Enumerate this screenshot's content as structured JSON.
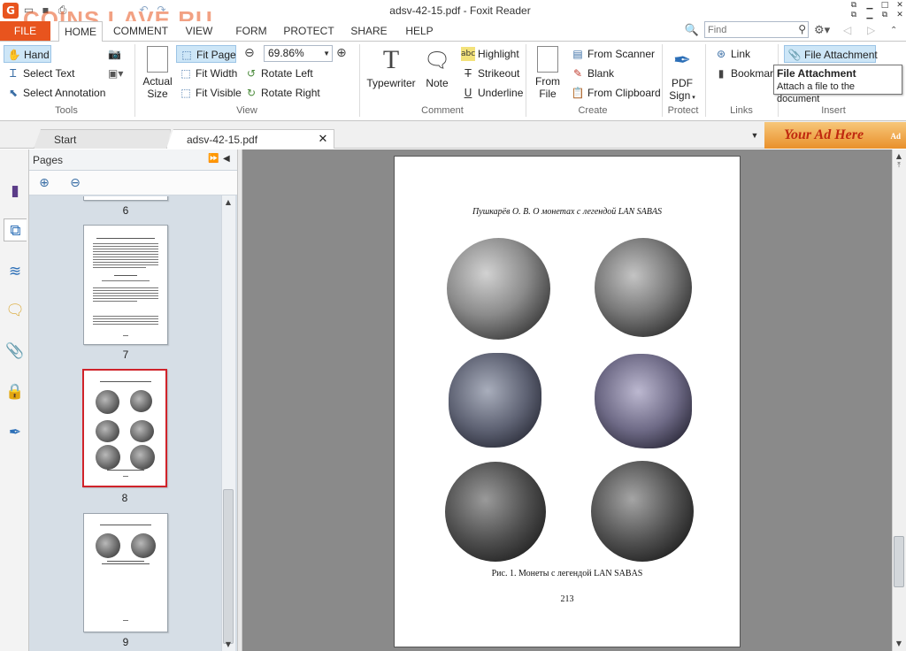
{
  "watermark": "COINS LAVE.RU",
  "window": {
    "title": "adsv-42-15.pdf - Foxit Reader"
  },
  "ribbon_tabs": [
    "FILE",
    "HOME",
    "COMMENT",
    "VIEW",
    "FORM",
    "PROTECT",
    "SHARE",
    "HELP"
  ],
  "find": {
    "placeholder": "Find"
  },
  "tools": {
    "hand": "Hand",
    "select_text": "Select Text",
    "select_annotation": "Select Annotation",
    "group": "Tools"
  },
  "view": {
    "actual_size": "Actual Size",
    "actual_size_l1": "Actual",
    "actual_size_l2": "Size",
    "fit_page": "Fit Page",
    "fit_width": "Fit Width",
    "fit_visible": "Fit Visible",
    "zoom_value": "69.86%",
    "rotate_left": "Rotate Left",
    "rotate_right": "Rotate Right",
    "group": "View"
  },
  "comment": {
    "typewriter": "Typewriter",
    "note": "Note",
    "highlight": "Highlight",
    "strikeout": "Strikeout",
    "underline": "Underline",
    "group": "Comment"
  },
  "create": {
    "from_file_l1": "From",
    "from_file_l2": "File",
    "from_scanner": "From Scanner",
    "blank": "Blank",
    "from_clipboard": "From Clipboard",
    "group": "Create"
  },
  "protect": {
    "pdf_sign_l1": "PDF",
    "pdf_sign_l2": "Sign",
    "group": "Protect"
  },
  "links": {
    "link": "Link",
    "bookmark": "Bookmark",
    "group": "Links"
  },
  "insert": {
    "file_attachment": "File Attachment",
    "group": "Insert"
  },
  "tooltip": {
    "title": "File Attachment",
    "body": "Attach a file to the document"
  },
  "doc_tabs": [
    {
      "label": "Start"
    },
    {
      "label": "adsv-42-15.pdf"
    }
  ],
  "ad": {
    "text": "Your Ad Here",
    "badge": "Ad"
  },
  "pages_panel": {
    "title": "Pages",
    "page_labels": [
      "6",
      "7",
      "8",
      "9"
    ],
    "selected_page": "8"
  },
  "pdf_page": {
    "header": "Пушкарёв О. В. О монетах с легендой LAN SABAS",
    "caption": "Рис. 1. Монеты с легендой LAN SABAS",
    "page_number": "213"
  }
}
